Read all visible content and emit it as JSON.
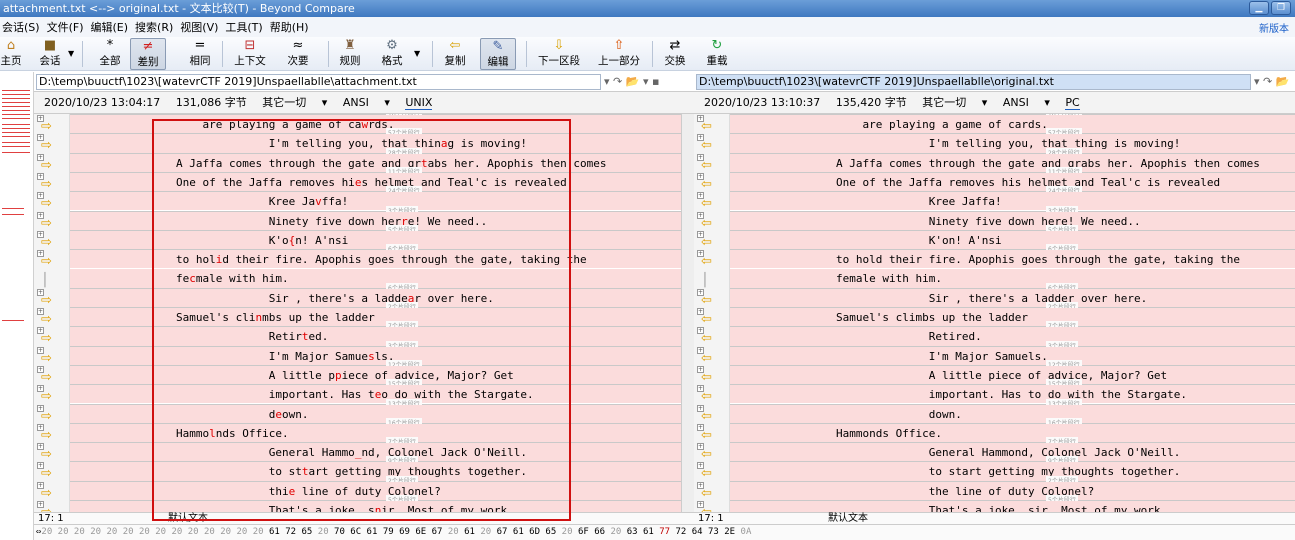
{
  "window": {
    "title": "attachment.txt <--> original.txt - 文本比较(T) - Beyond Compare",
    "minimize_icon": "minimize-icon",
    "restore_icon": "restore-icon"
  },
  "menu": {
    "items": [
      "会话(S)",
      "文件(F)",
      "编辑(E)",
      "搜索(R)",
      "视图(V)",
      "工具(T)",
      "帮助(H)"
    ],
    "new_version": "新版本"
  },
  "toolbar": {
    "home": "主页",
    "session": "会话",
    "all": "全部",
    "diffs": "差别",
    "same": "相同",
    "context": "上下文",
    "minor": "次要",
    "rules": "规则",
    "format": "格式",
    "copy": "复制",
    "edit": "编辑",
    "next_section": "下一区段",
    "prev_section": "上一部分",
    "swap": "交换",
    "reload": "重载"
  },
  "left": {
    "path": "D:\\temp\\buuctf\\1023\\[watevrCTF 2019]Unspaellablle\\attachment.txt",
    "date": "2020/10/23 13:04:17",
    "size": "131,086 字节",
    "other": "其它一切",
    "encoding": "ANSI",
    "lineend": "UNIX",
    "status_pos": "17: 1",
    "status_type": "默认文本"
  },
  "right": {
    "path": "D:\\temp\\buuctf\\1023\\[watevrCTF 2019]Unspaellablle\\original.txt",
    "date": "2020/10/23 13:10:37",
    "size": "135,420 字节",
    "other": "其它一切",
    "encoding": "ANSI",
    "lineend": "PC",
    "status_pos": "17: 1",
    "status_type": "默认文本"
  },
  "separators": [
    "16个片段行",
    "57个片段行",
    "28个片段行",
    "11个片段行",
    "24个片段行",
    "3个片段行",
    "5个片段行",
    "6个片段行",
    "",
    "6个片段行",
    "2个片段行",
    "7个片段行",
    "3个片段行",
    "12个片段行",
    "15个片段行",
    "13个片段行",
    "16个片段行",
    "7个片段行",
    "9个片段行",
    "2个片段行",
    "5个片段行"
  ],
  "left_lines": [
    {
      "i": 0,
      "parts": [
        [
          "    are playing a game of ca",
          ""
        ],
        [
          "w",
          "d"
        ],
        [
          "rds.",
          ""
        ]
      ]
    },
    {
      "i": 1,
      "parts": [
        [
          "              I'm telling you, that thin",
          ""
        ],
        [
          "a",
          "d"
        ],
        [
          "g is moving!",
          ""
        ]
      ]
    },
    {
      "i": 2,
      "parts": [
        [
          "A Jaffa comes through the gate and gr",
          ""
        ],
        [
          "t",
          "d"
        ],
        [
          "abs her. Apophis then comes",
          ""
        ]
      ]
    },
    {
      "i": 3,
      "parts": [
        [
          "One of the Jaffa removes hi",
          ""
        ],
        [
          "e",
          "d"
        ],
        [
          "s helmet and Teal'c is revealed",
          ""
        ]
      ]
    },
    {
      "i": 4,
      "parts": [
        [
          "              Kree Ja",
          ""
        ],
        [
          "v",
          "d"
        ],
        [
          "ffa!",
          ""
        ]
      ]
    },
    {
      "i": 5,
      "parts": [
        [
          "              Ninety five down her",
          ""
        ],
        [
          "r",
          "d"
        ],
        [
          "e! We need..",
          ""
        ]
      ]
    },
    {
      "i": 6,
      "parts": [
        [
          "              K'o",
          ""
        ],
        [
          "{",
          "d"
        ],
        [
          "n! A'nsi",
          ""
        ]
      ]
    },
    {
      "i": 7,
      "parts": [
        [
          "to hol",
          ""
        ],
        [
          "i",
          "d"
        ],
        [
          "d their fire. Apophis goes through the gate, taking the",
          ""
        ]
      ]
    },
    {
      "i": 8,
      "parts": [
        [
          "fe",
          ""
        ],
        [
          "c",
          "d"
        ],
        [
          "male with him.",
          ""
        ]
      ]
    },
    {
      "i": 9,
      "parts": [
        [
          "              Sir , there's a ladde",
          ""
        ],
        [
          "a",
          "d"
        ],
        [
          "r over here.",
          ""
        ]
      ]
    },
    {
      "i": 10,
      "parts": [
        [
          "Samuel's cli",
          ""
        ],
        [
          "n",
          "d"
        ],
        [
          "mbs up the ladder",
          ""
        ]
      ]
    },
    {
      "i": 11,
      "parts": [
        [
          "              Retir",
          ""
        ],
        [
          "t",
          "d"
        ],
        [
          "ed.",
          ""
        ]
      ]
    },
    {
      "i": 12,
      "parts": [
        [
          "              I'm Major Samue",
          ""
        ],
        [
          "s",
          "d"
        ],
        [
          "ls.",
          ""
        ]
      ]
    },
    {
      "i": 13,
      "parts": [
        [
          "              A little p",
          ""
        ],
        [
          "p",
          "d"
        ],
        [
          "iece of advice, Major? Get",
          ""
        ]
      ]
    },
    {
      "i": 14,
      "parts": [
        [
          "              important. Has t",
          ""
        ],
        [
          "e",
          "d"
        ],
        [
          "o do with the Stargate.",
          ""
        ]
      ]
    },
    {
      "i": 15,
      "parts": [
        [
          "              d",
          ""
        ],
        [
          "e",
          "d"
        ],
        [
          "own.",
          ""
        ]
      ]
    },
    {
      "i": 16,
      "parts": [
        [
          "Hammo",
          ""
        ],
        [
          "l",
          "d"
        ],
        [
          "nds Office.",
          ""
        ]
      ]
    },
    {
      "i": 17,
      "parts": [
        [
          "              General Hammo",
          ""
        ],
        [
          "_",
          "d"
        ],
        [
          "nd, Colonel Jack O'Neill.",
          ""
        ]
      ]
    },
    {
      "i": 18,
      "parts": [
        [
          "              to st",
          ""
        ],
        [
          "t",
          "d"
        ],
        [
          "art getting my thoughts together.",
          ""
        ]
      ]
    },
    {
      "i": 19,
      "parts": [
        [
          "              thi",
          ""
        ],
        [
          "e",
          "d"
        ],
        [
          " line of duty Colonel?",
          ""
        ]
      ]
    },
    {
      "i": 20,
      "parts": [
        [
          "              That's a joke. s",
          ""
        ],
        [
          "n",
          "d"
        ],
        [
          "ir. Most of my work",
          ""
        ]
      ]
    }
  ],
  "right_lines": [
    {
      "i": 0,
      "parts": [
        [
          "    are playing a game of cards.",
          ""
        ]
      ]
    },
    {
      "i": 1,
      "parts": [
        [
          "              I'm telling you, that thing is moving!",
          ""
        ]
      ]
    },
    {
      "i": 2,
      "parts": [
        [
          "A Jaffa comes through the gate and grabs her. Apophis then comes",
          ""
        ]
      ]
    },
    {
      "i": 3,
      "parts": [
        [
          "One of the Jaffa removes his helmet and Teal'c is revealed",
          ""
        ]
      ]
    },
    {
      "i": 4,
      "parts": [
        [
          "              Kree Jaffa!",
          ""
        ]
      ]
    },
    {
      "i": 5,
      "parts": [
        [
          "              Ninety five down here! We need..",
          ""
        ]
      ]
    },
    {
      "i": 6,
      "parts": [
        [
          "              K'on! A'nsi",
          ""
        ]
      ]
    },
    {
      "i": 7,
      "parts": [
        [
          "to hold their fire. Apophis goes through the gate, taking the",
          ""
        ]
      ]
    },
    {
      "i": 8,
      "parts": [
        [
          "female with him.",
          ""
        ]
      ]
    },
    {
      "i": 9,
      "parts": [
        [
          "              Sir , there's a ladder over here.",
          ""
        ]
      ]
    },
    {
      "i": 10,
      "parts": [
        [
          "Samuel's climbs up the ladder",
          ""
        ]
      ]
    },
    {
      "i": 11,
      "parts": [
        [
          "              Retired.",
          ""
        ]
      ]
    },
    {
      "i": 12,
      "parts": [
        [
          "              I'm Major Samuels.",
          ""
        ]
      ]
    },
    {
      "i": 13,
      "parts": [
        [
          "              A little piece of advice, Major? Get",
          ""
        ]
      ]
    },
    {
      "i": 14,
      "parts": [
        [
          "              important. Has to do with the Stargate.",
          ""
        ]
      ]
    },
    {
      "i": 15,
      "parts": [
        [
          "              down.",
          ""
        ]
      ]
    },
    {
      "i": 16,
      "parts": [
        [
          "Hammonds Office.",
          ""
        ]
      ]
    },
    {
      "i": 17,
      "parts": [
        [
          "              General Hammond, Colonel Jack O'Neill.",
          ""
        ]
      ]
    },
    {
      "i": 18,
      "parts": [
        [
          "              to start getting my thoughts together.",
          ""
        ]
      ]
    },
    {
      "i": 19,
      "parts": [
        [
          "              the line of duty Colonel?",
          ""
        ]
      ]
    },
    {
      "i": 20,
      "parts": [
        [
          "              That's a joke. sir. Most of my work",
          ""
        ]
      ]
    }
  ],
  "hex": [
    [
      "20 20 20 20 20 20 20 20 20 20 20 20 20 20 ",
      "g"
    ],
    [
      "61 72 65 ",
      ""
    ],
    [
      "20 ",
      "g"
    ],
    [
      "70 6C 61 79 69 6E 67 ",
      ""
    ],
    [
      "20 ",
      "g"
    ],
    [
      "61 ",
      ""
    ],
    [
      "20 ",
      "g"
    ],
    [
      "67 61 6D 65 ",
      ""
    ],
    [
      "20 ",
      "g"
    ],
    [
      "6F 66 ",
      ""
    ],
    [
      "20 ",
      "g"
    ],
    [
      "63 61 ",
      ""
    ],
    [
      "77 ",
      "h"
    ],
    [
      "72 64 73 2E ",
      ""
    ],
    [
      "0A",
      "g"
    ]
  ]
}
